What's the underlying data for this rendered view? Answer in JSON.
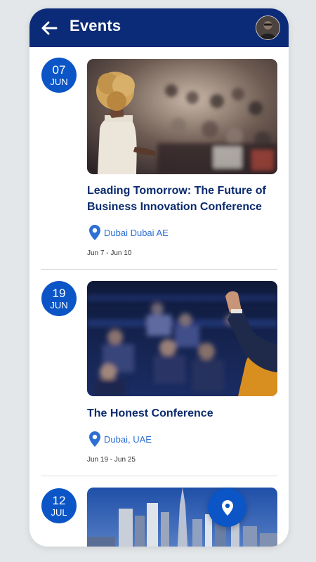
{
  "header": {
    "title": "Events",
    "back_icon": "arrow-left-icon",
    "avatar_icon": "user-avatar"
  },
  "events": [
    {
      "day": "07",
      "month": "JUN",
      "name": "Leading Tomorrow: The Future of Business Innovation Conference",
      "location": "Dubai Dubai AE",
      "dates": "Jun 7 - Jun 10",
      "image": "speaker-at-conference-photo"
    },
    {
      "day": "19",
      "month": "JUN",
      "name": "The Honest Conference",
      "location": "Dubai, UAE",
      "dates": "Jun 19 - Jun 25",
      "image": "audience-in-auditorium-photo"
    },
    {
      "day": "12",
      "month": "JUL",
      "image": "city-skyline-photo"
    }
  ],
  "fab": {
    "icon": "map-pin-icon"
  },
  "colors": {
    "header": "#0b2a78",
    "accent": "#0b55c6",
    "title_text": "#0a2a6e",
    "location_text": "#2d6fd2"
  }
}
